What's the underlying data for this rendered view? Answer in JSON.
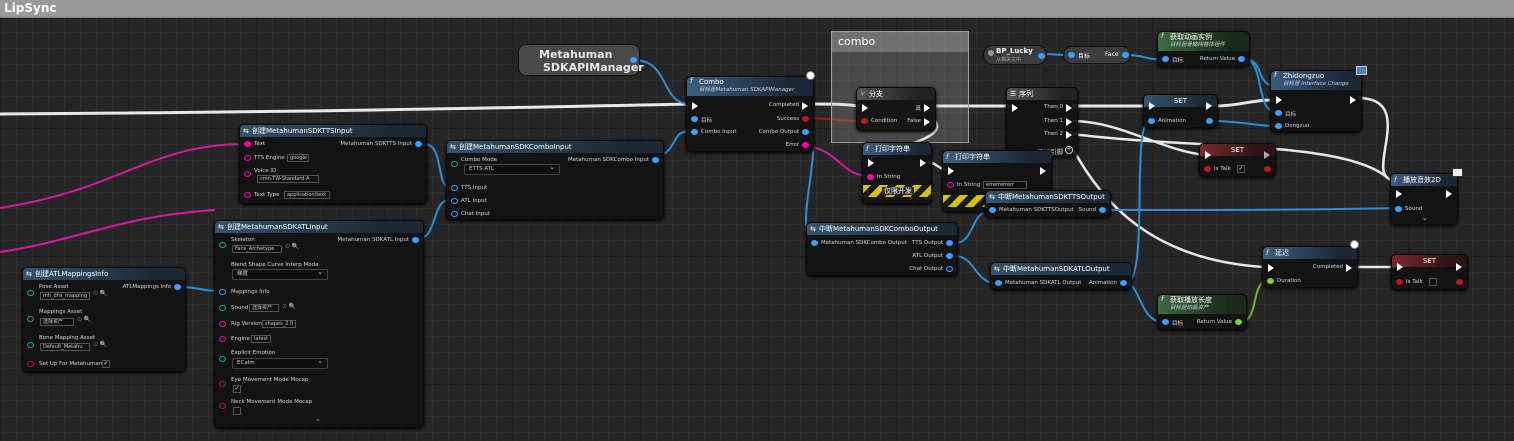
{
  "window": {
    "title": "LipSync"
  },
  "comment_box": {
    "title": "combo"
  },
  "var_node": {
    "line1": "Metahuman",
    "line2": "SDKAPIManager"
  },
  "bp_lucky": {
    "title": "BP_Lucky",
    "subtitle": "从相关文中"
  },
  "get_face": {
    "target": "目标",
    "out": "Face"
  },
  "get_anim": {
    "title": "获取动画实例",
    "subtitle": "目标是骨骼网格体组件",
    "target": "目标",
    "out": "Return Value"
  },
  "zhidongzuo": {
    "title": "Zhidongzuo",
    "subtitle": "目标是 Interface Change",
    "target": "目标",
    "in": "Dongzuo"
  },
  "combo_fn": {
    "title": "Combo",
    "subtitle": "目标是Metahuman SDKAPIManager",
    "target": "目标",
    "in": "Combo Input",
    "out_completed": "Completed",
    "out_success": "Success",
    "out_combo": "Combo Output",
    "out_error": "Error"
  },
  "branch": {
    "title": "分支",
    "condition": "Condition",
    "true_label": "真",
    "false_label": "False"
  },
  "sequence": {
    "title": "序列",
    "then0": "Then 0",
    "then1": "Then 1",
    "then2": "Then 2",
    "add_pin": "添加引脚"
  },
  "set_anim": {
    "title": "SET",
    "pin": "Animation"
  },
  "set_istalk1": {
    "title": "SET",
    "pin": "Is Talk"
  },
  "set_istalk2": {
    "title": "SET",
    "pin": "Is Talk"
  },
  "play_sound": {
    "title": "播放音效2D",
    "pin": "Sound"
  },
  "delay": {
    "title": "延迟",
    "duration": "Duration",
    "completed": "Completed"
  },
  "get_duration": {
    "title": "获取播放长度",
    "subtitle": "目标是动画资产",
    "target": "目标",
    "out": "Return Value"
  },
  "print1": {
    "title": "打印字符串",
    "in": "In String",
    "badge": "仅限开发"
  },
  "print2": {
    "title": "打印字符串",
    "in": "In String",
    "value": "errerrerrerr"
  },
  "break_tts": {
    "title": "中断MetahumanSDKTTSOutput",
    "in": "Metahuman SDKTTSOutput",
    "out": "Sound"
  },
  "break_combo": {
    "title": "中断MetahumanSDKComboOutput",
    "in": "Metahuman SDKCombo Output",
    "out_tts": "TTS Output",
    "out_atl": "ATL Output",
    "out_chat": "Chat Output"
  },
  "break_atl": {
    "title": "中断MetahumanSDKATLOutput",
    "in": "Metahuman SDKATL Output",
    "out": "Animation"
  },
  "make_tts": {
    "title": "创建MetahumanSDKTTSInput",
    "text": "Text",
    "engine_label": "TTS Engine",
    "engine_value": "google",
    "voice_label": "Voice ID",
    "voice_value": "cmn-TW-Standard-A",
    "type_label": "Text Type",
    "type_value": "application/text",
    "out": "Metahuman SDKTTS Input"
  },
  "make_combo": {
    "title": "创建MetahumanSDKComboInput",
    "mode_label": "Combo Mode",
    "mode_value": "ETTS ATL",
    "tts_in": "TTS Input",
    "atl_in": "ATL Input",
    "chat_in": "Chat Input",
    "out": "Metahuman SDKCombo Input"
  },
  "make_atl": {
    "title": "创建MetahumanSDKATLInput",
    "skeleton_label": "Skeleton",
    "skeleton_value": "Face_Archetype",
    "blend_label": "Blend Shape Curve Interp Mode",
    "blend_value": "梯度",
    "map_label": "Mappings Info",
    "sound_label": "Sound",
    "sound_value": "选择资产",
    "rig_label": "Rig Version",
    "rig_value": "shapes_2.0",
    "engine_label": "Engine",
    "engine_value": "latest",
    "emotion_label": "Explicit Emotion",
    "emotion_value": "ECalm",
    "eye_label": "Eye Movement Mode Mocap",
    "neck_label": "Neck Movement Mode Mocap",
    "out": "Metahuman SDKATL Input"
  },
  "make_map": {
    "title": "创建ATLMappingsInfo",
    "pose_label": "Pose Asset",
    "pose_value": "mh_dhs_mapping",
    "mappings_label": "Mappings Asset",
    "mappings_value": "选择资产",
    "bone_label": "Bone Mapping Asset",
    "bone_value": "Default_Metahu",
    "setup_label": "Set Up For Metahumans",
    "out": "ATLMappings Info"
  },
  "colors": {
    "exec": "#ffffff",
    "struct": "#3aa0ff",
    "string": "#ff00aa",
    "bool": "#c21a1a",
    "float": "#7bd13b"
  }
}
